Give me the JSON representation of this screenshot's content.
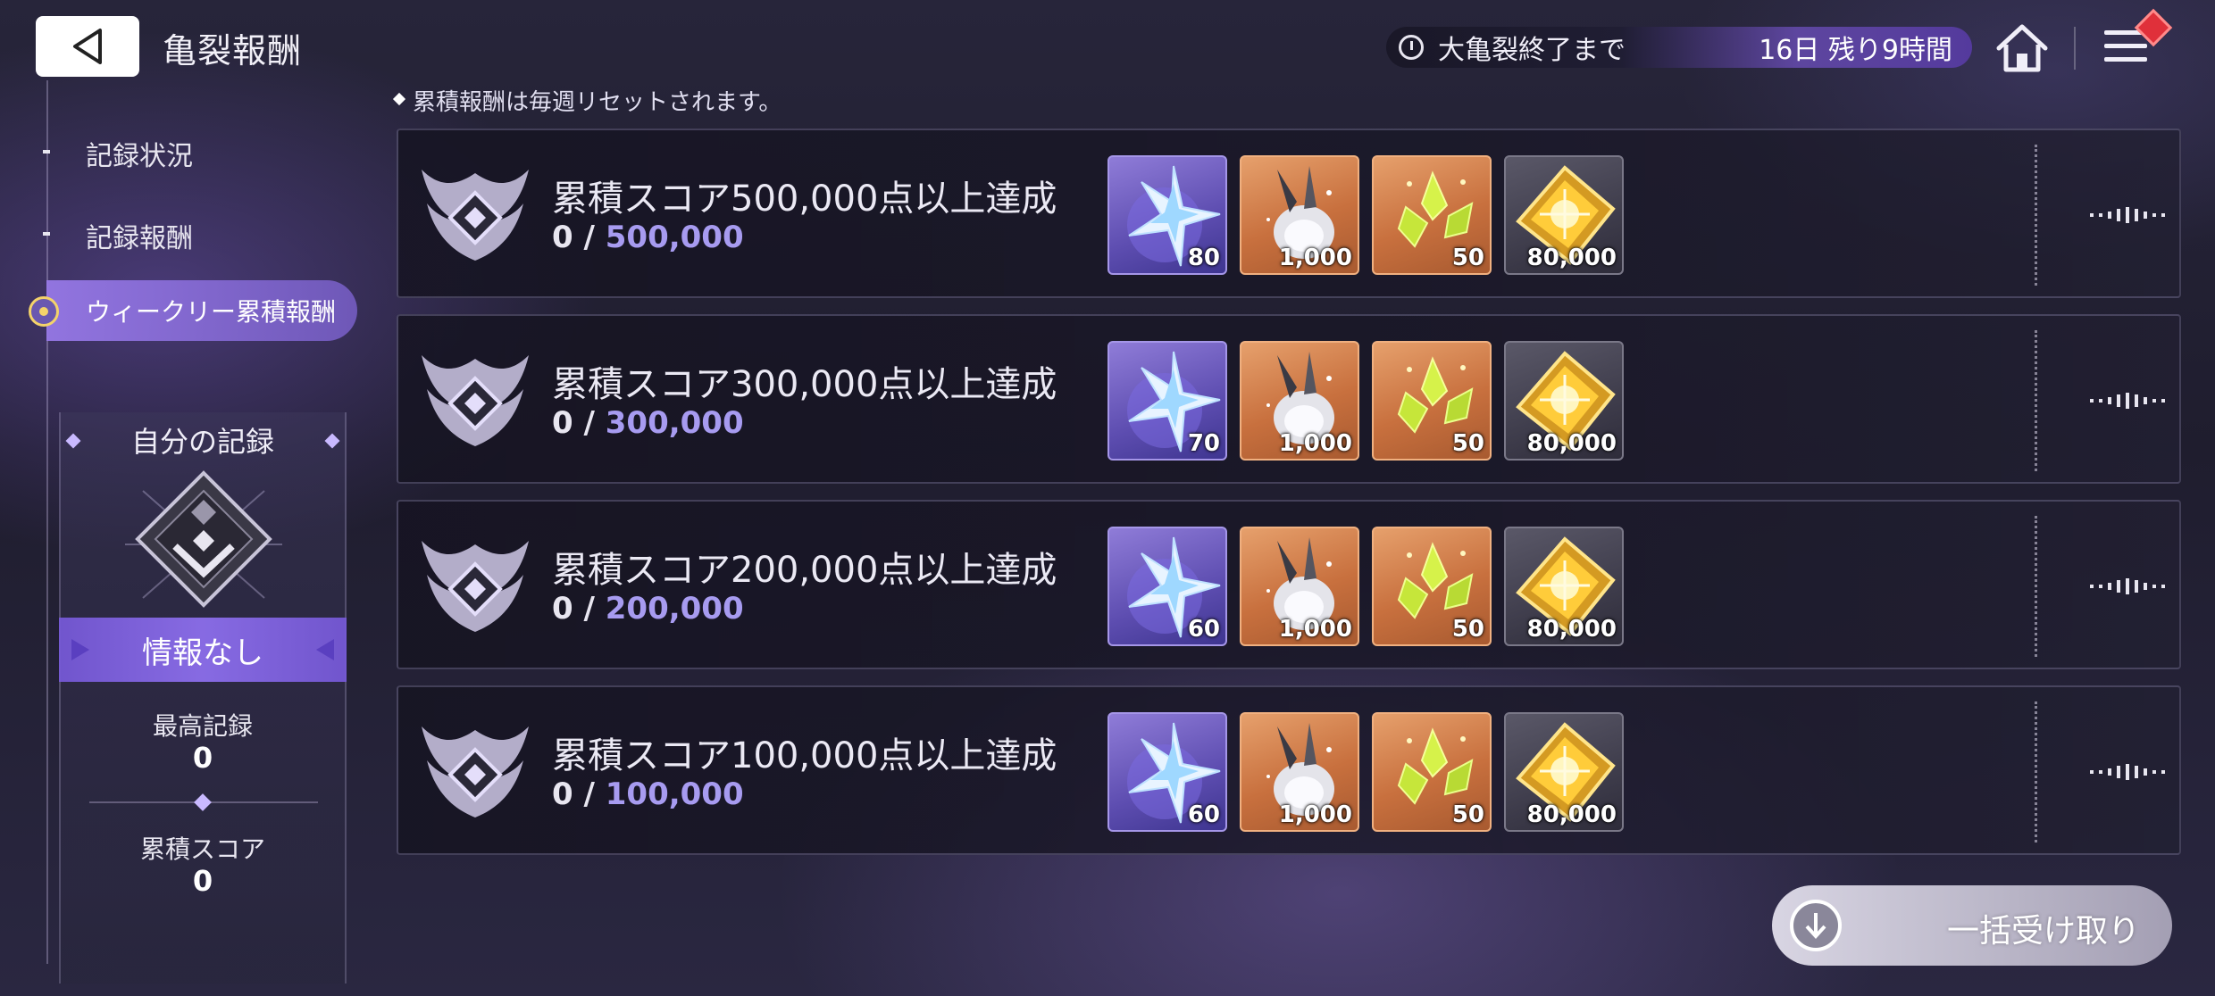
{
  "header": {
    "back_icon": "back-arrow-icon",
    "title": "亀裂報酬",
    "timer_label": "大亀裂終了まで",
    "timer_value": "16日 残り9時間",
    "home_icon": "home-icon",
    "menu_icon": "menu-icon"
  },
  "sidebar": {
    "items": [
      {
        "label": "記録状況"
      },
      {
        "label": "記録報酬"
      },
      {
        "label": "ウィークリー累積報酬"
      }
    ],
    "active_index": 2
  },
  "record": {
    "title": "自分の記録",
    "rank_text": "情報なし",
    "best_label": "最高記録",
    "best_value": "0",
    "score_label": "累積スコア",
    "score_value": "0"
  },
  "notice": "累積報酬は毎週リセットされます。",
  "rewards": [
    {
      "title": "累積スコア500,000点以上達成",
      "current": "0",
      "sep": " / ",
      "goal": "500,000",
      "items": [
        {
          "icon": "star-crystal-icon",
          "count": "80",
          "color": "purple"
        },
        {
          "icon": "silver-rabbit-icon",
          "count": "1,000",
          "color": "orange"
        },
        {
          "icon": "green-leaf-gem-icon",
          "count": "50",
          "color": "orange"
        },
        {
          "icon": "gold-gem-icon",
          "count": "80,000",
          "color": "gray"
        }
      ]
    },
    {
      "title": "累積スコア300,000点以上達成",
      "current": "0",
      "sep": " / ",
      "goal": "300,000",
      "items": [
        {
          "icon": "star-crystal-icon",
          "count": "70",
          "color": "purple"
        },
        {
          "icon": "silver-rabbit-icon",
          "count": "1,000",
          "color": "orange"
        },
        {
          "icon": "green-leaf-gem-icon",
          "count": "50",
          "color": "orange"
        },
        {
          "icon": "gold-gem-icon",
          "count": "80,000",
          "color": "gray"
        }
      ]
    },
    {
      "title": "累積スコア200,000点以上達成",
      "current": "0",
      "sep": " / ",
      "goal": "200,000",
      "items": [
        {
          "icon": "star-crystal-icon",
          "count": "60",
          "color": "purple"
        },
        {
          "icon": "silver-rabbit-icon",
          "count": "1,000",
          "color": "orange"
        },
        {
          "icon": "green-leaf-gem-icon",
          "count": "50",
          "color": "orange"
        },
        {
          "icon": "gold-gem-icon",
          "count": "80,000",
          "color": "gray"
        }
      ]
    },
    {
      "title": "累積スコア100,000点以上達成",
      "current": "0",
      "sep": " / ",
      "goal": "100,000",
      "items": [
        {
          "icon": "star-crystal-icon",
          "count": "60",
          "color": "purple"
        },
        {
          "icon": "silver-rabbit-icon",
          "count": "1,000",
          "color": "orange"
        },
        {
          "icon": "green-leaf-gem-icon",
          "count": "50",
          "color": "orange"
        },
        {
          "icon": "gold-gem-icon",
          "count": "80,000",
          "color": "gray"
        }
      ]
    }
  ],
  "claim_all": {
    "label": "一括受け取り",
    "icon": "download-arrow-icon"
  },
  "colors": {
    "accent": "#8f78e0",
    "goal_text": "#a79bf0",
    "badge": "#e0303a"
  }
}
